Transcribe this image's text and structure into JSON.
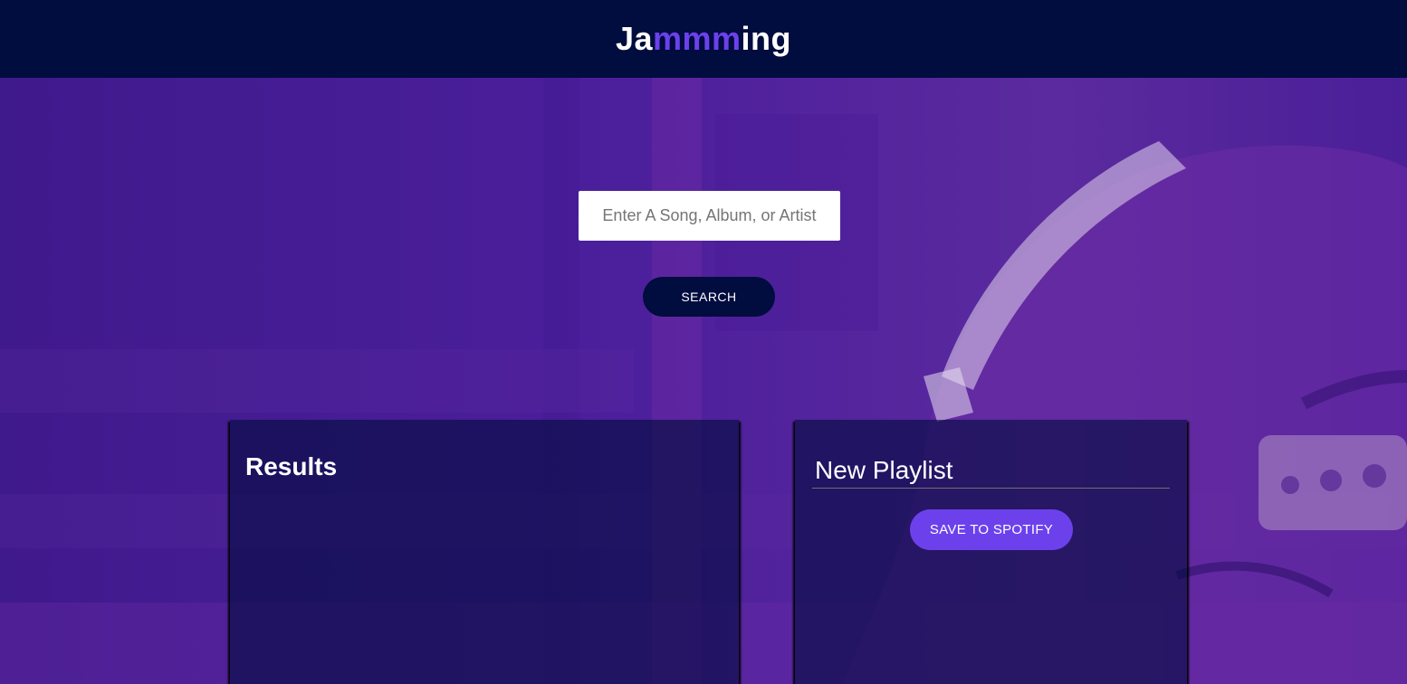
{
  "app": {
    "logo_prefix": "Ja",
    "logo_accent": "mmm",
    "logo_suffix": "ing"
  },
  "colors": {
    "header_bg": "#010c3f",
    "accent": "#6c41ec",
    "background": "#4a1f9a"
  },
  "search": {
    "placeholder": "Enter A Song, Album, or Artist",
    "value": "",
    "button_label": "SEARCH"
  },
  "results": {
    "title": "Results",
    "tracks": []
  },
  "playlist": {
    "name": "New Playlist",
    "save_label": "SAVE TO SPOTIFY",
    "tracks": []
  },
  "background_image": {
    "icon": "headphones-photo-background"
  }
}
